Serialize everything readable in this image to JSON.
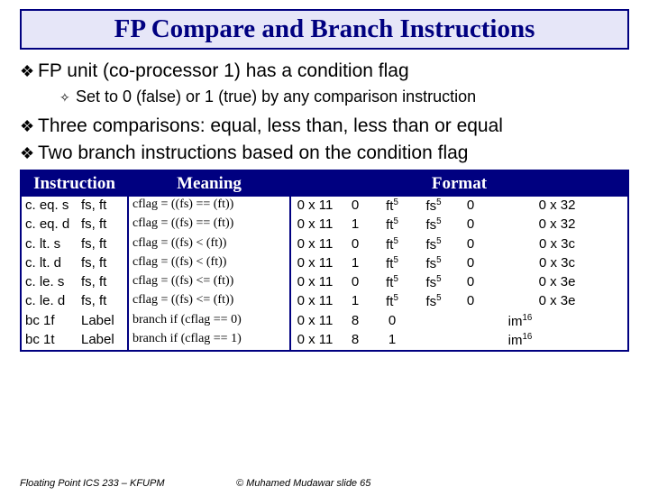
{
  "title": "FP Compare and Branch Instructions",
  "bullets": {
    "b1": "FP unit (co-processor 1) has a condition flag",
    "b1a": "Set to 0 (false) or 1 (true) by any comparison instruction",
    "b2": "Three comparisons: equal, less than, less than or equal",
    "b3": "Two branch instructions based on the condition flag"
  },
  "headers": {
    "instruction": "Instruction",
    "meaning": "Meaning",
    "format": "Format"
  },
  "rows": [
    {
      "mn": "c. eq. s",
      "ops": "fs, ft",
      "meaning": "cflag = ((fs) == (ft))",
      "f0": "0 x 11",
      "f1": "0",
      "f2": "ft",
      "f2s": "5",
      "f3": "fs",
      "f3s": "5",
      "f4": "0",
      "f5": "0 x 32"
    },
    {
      "mn": "c. eq. d",
      "ops": "fs, ft",
      "meaning": "cflag = ((fs) == (ft))",
      "f0": "0 x 11",
      "f1": "1",
      "f2": "ft",
      "f2s": "5",
      "f3": "fs",
      "f3s": "5",
      "f4": "0",
      "f5": "0 x 32"
    },
    {
      "mn": "c. lt. s",
      "ops": "fs, ft",
      "meaning": "cflag = ((fs) <  (ft))",
      "f0": "0 x 11",
      "f1": "0",
      "f2": "ft",
      "f2s": "5",
      "f3": "fs",
      "f3s": "5",
      "f4": "0",
      "f5": "0 x 3c"
    },
    {
      "mn": "c. lt. d",
      "ops": "fs, ft",
      "meaning": "cflag = ((fs) <  (ft))",
      "f0": "0 x 11",
      "f1": "1",
      "f2": "ft",
      "f2s": "5",
      "f3": "fs",
      "f3s": "5",
      "f4": "0",
      "f5": "0 x 3c"
    },
    {
      "mn": "c. le. s",
      "ops": "fs, ft",
      "meaning": "cflag = ((fs) <= (ft))",
      "f0": "0 x 11",
      "f1": "0",
      "f2": "ft",
      "f2s": "5",
      "f3": "fs",
      "f3s": "5",
      "f4": "0",
      "f5": "0 x 3e"
    },
    {
      "mn": "c. le. d",
      "ops": "fs, ft",
      "meaning": "cflag = ((fs) <= (ft))",
      "f0": "0 x 11",
      "f1": "1",
      "f2": "ft",
      "f2s": "5",
      "f3": "fs",
      "f3s": "5",
      "f4": "0",
      "f5": "0 x 3e"
    },
    {
      "mn": "bc 1f",
      "ops": "Label",
      "meaning": "branch if (cflag == 0)",
      "f0": "0 x 11",
      "f1": "8",
      "f2": "0",
      "imm": "im",
      "imms": "16"
    },
    {
      "mn": "bc 1t",
      "ops": "Label",
      "meaning": "branch if (cflag == 1)",
      "f0": "0 x 11",
      "f1": "8",
      "f2": "1",
      "imm": "im",
      "imms": "16"
    }
  ],
  "footer": {
    "f1": "Floating Point",
    "f2": "ICS 233 – KFUPM",
    "f3": "© Muhamed Mudawar  slide 65"
  }
}
